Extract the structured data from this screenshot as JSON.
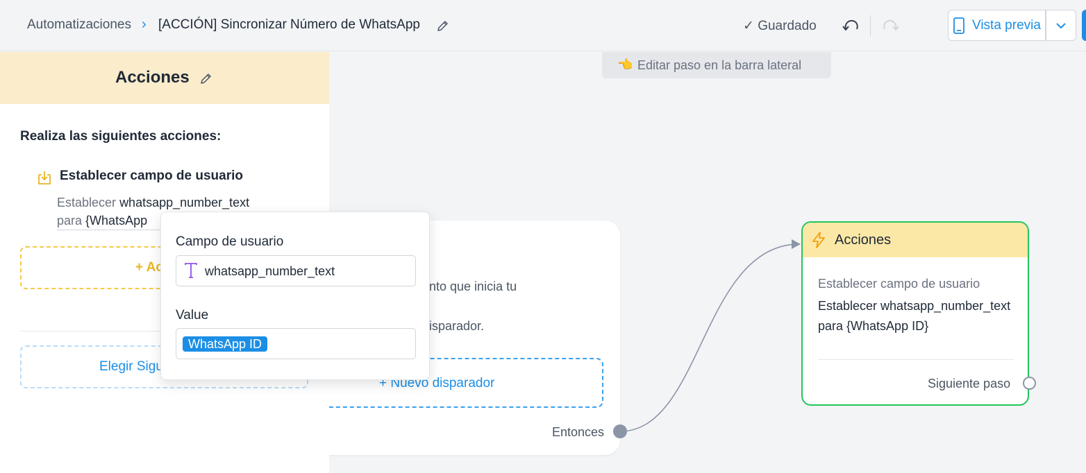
{
  "header": {
    "breadcrumb_root": "Automatizaciones",
    "breadcrumb_sep": "›",
    "title": "[ACCIÓN] Sincronizar Número de WhatsApp",
    "saved": "✓ Guardado",
    "preview_label": "Vista previa"
  },
  "canvas": {
    "hint_icon": "👈",
    "hint_text": "Editar paso en la barra lateral",
    "trigger": {
      "desc_line1": "nto que inicia tu",
      "desc_line2": "isparador.",
      "new_trigger": "+ Nuevo disparador",
      "then_label": "Entonces"
    },
    "actions_node": {
      "title": "Acciones",
      "subtitle": "Establecer campo de usuario",
      "body": "Establecer whatsapp_number_text para {WhatsApp ID}",
      "next_step": "Siguiente paso"
    }
  },
  "sidebar": {
    "title": "Acciones",
    "perform_label": "Realiza las siguientes acciones:",
    "action": {
      "title": "Establecer campo de usuario",
      "desc_prefix": "Establecer",
      "desc_field": "whatsapp_number_text",
      "desc_mid": "para",
      "desc_value": "{WhatsApp"
    },
    "add_action": "+ Ac",
    "choose_next": "Elegir Sigu"
  },
  "popover": {
    "field_label": "Campo de usuario",
    "field_value": "whatsapp_number_text",
    "value_label": "Value",
    "value_chip": "WhatsApp ID"
  },
  "colors": {
    "accent": "#1b8ee6",
    "success": "#22c55e",
    "panel_header": "#fbeccb",
    "node_header": "#fbe8a6"
  },
  "icons": [
    "chevron-right-icon",
    "pencil-icon",
    "check-icon",
    "undo-icon",
    "redo-icon",
    "phone-icon",
    "chevron-down-icon",
    "hand-point-icon",
    "lightning-icon",
    "download-box-icon",
    "text-type-icon"
  ]
}
